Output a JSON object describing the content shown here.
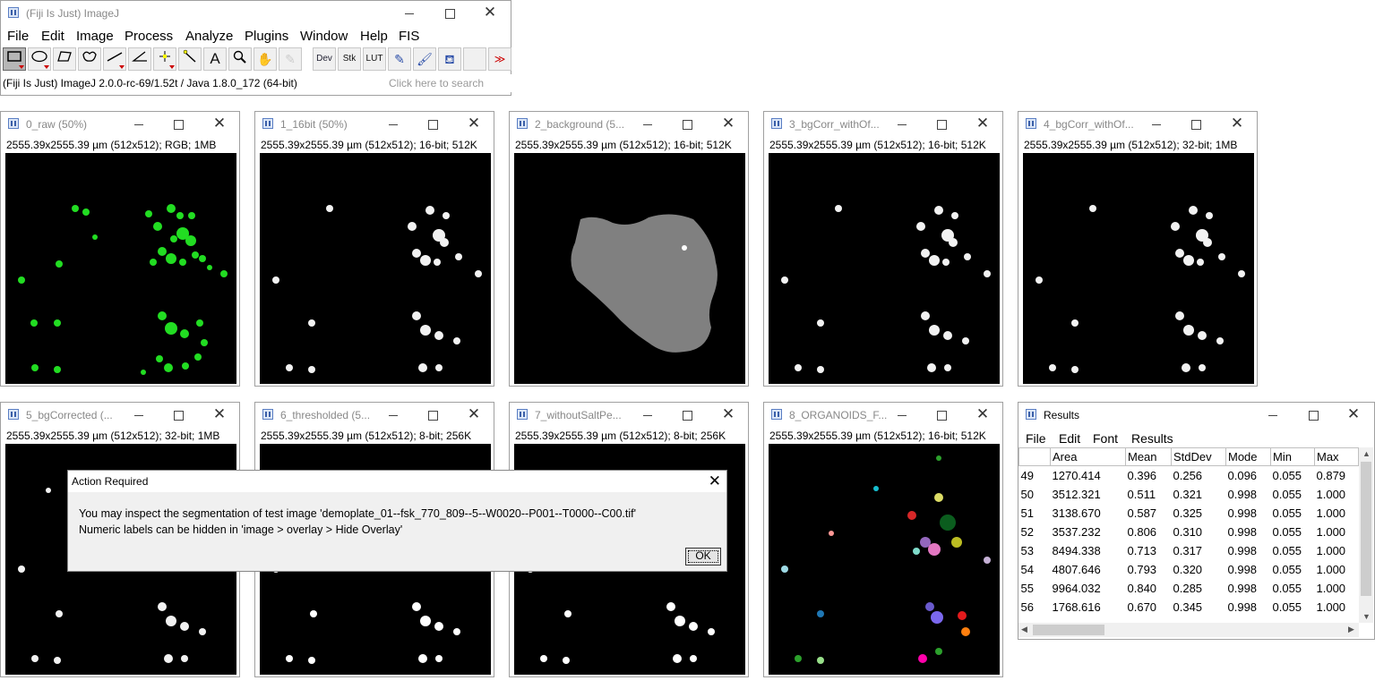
{
  "main": {
    "title": "(Fiji Is Just) ImageJ",
    "menus": [
      "File",
      "Edit",
      "Image",
      "Process",
      "Analyze",
      "Plugins",
      "Window",
      "Help",
      "FIS"
    ],
    "tools": {
      "dev": "Dev",
      "stk": "Stk",
      "lut": "LUT",
      "more": "≫"
    },
    "status": "(Fiji Is Just) ImageJ 2.0.0-rc-69/1.52t / Java 1.8.0_172 (64-bit)",
    "search_placeholder": "Click here to search"
  },
  "windows": [
    {
      "title": "0_raw (50%)",
      "info": "2555.39x2555.39 µm (512x512); RGB; 1MB"
    },
    {
      "title": "1_16bit (50%)",
      "info": "2555.39x2555.39 µm (512x512); 16-bit; 512K"
    },
    {
      "title": "2_background (5...",
      "info": "2555.39x2555.39 µm (512x512); 16-bit; 512K"
    },
    {
      "title": "3_bgCorr_withOf...",
      "info": "2555.39x2555.39 µm (512x512); 16-bit; 512K"
    },
    {
      "title": "4_bgCorr_withOf...",
      "info": "2555.39x2555.39 µm (512x512); 32-bit; 1MB"
    },
    {
      "title": "5_bgCorrected (...",
      "info": "2555.39x2555.39 µm (512x512); 32-bit; 1MB"
    },
    {
      "title": "6_thresholded (5...",
      "info": "2555.39x2555.39 µm (512x512); 8-bit; 256K"
    },
    {
      "title": "7_withoutSaltPe...",
      "info": "2555.39x2555.39 µm (512x512); 8-bit; 256K"
    },
    {
      "title": "8_ORGANOIDS_F...",
      "info": "2555.39x2555.39 µm (512x512); 16-bit; 512K"
    }
  ],
  "dialog": {
    "title": "Action Required",
    "line1": "You may inspect the segmentation of test image 'demoplate_01--fsk_770_809--5--W0020--P001--T0000--C00.tif'",
    "line2": "Numeric labels can be hidden in 'image > overlay > Hide Overlay'",
    "ok": "OK"
  },
  "results": {
    "title": "Results",
    "menus": [
      "File",
      "Edit",
      "Font",
      "Results"
    ],
    "columns": [
      "",
      "Area",
      "Mean",
      "StdDev",
      "Mode",
      "Min",
      "Max"
    ],
    "rows": [
      [
        "49",
        "1270.414",
        "0.396",
        "0.256",
        "0.096",
        "0.055",
        "0.879"
      ],
      [
        "50",
        "3512.321",
        "0.511",
        "0.321",
        "0.998",
        "0.055",
        "1.000"
      ],
      [
        "51",
        "3138.670",
        "0.587",
        "0.325",
        "0.998",
        "0.055",
        "1.000"
      ],
      [
        "52",
        "3537.232",
        "0.806",
        "0.310",
        "0.998",
        "0.055",
        "1.000"
      ],
      [
        "53",
        "8494.338",
        "0.713",
        "0.317",
        "0.998",
        "0.055",
        "1.000"
      ],
      [
        "54",
        "4807.646",
        "0.793",
        "0.320",
        "0.998",
        "0.055",
        "1.000"
      ],
      [
        "55",
        "9964.032",
        "0.840",
        "0.285",
        "0.998",
        "0.055",
        "1.000"
      ],
      [
        "56",
        "1768.616",
        "0.670",
        "0.345",
        "0.998",
        "0.055",
        "1.000"
      ]
    ]
  },
  "colors": {
    "green_blobs": "#22dd22",
    "white_blobs": "#f2f2f2",
    "background_gray": "#808080",
    "label_cyan": "#20a0a0"
  }
}
